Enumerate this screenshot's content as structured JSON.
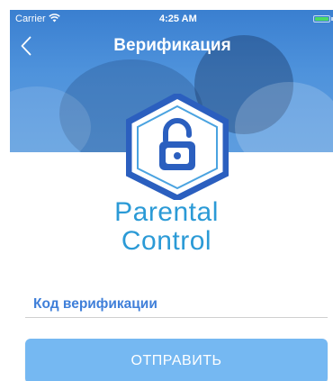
{
  "status_bar": {
    "carrier": "Carrier",
    "time": "4:25 AM",
    "wifi_icon": "wifi-icon",
    "battery_icon": "battery-icon"
  },
  "nav": {
    "title": "Верификация",
    "back_icon": "chevron-left-icon",
    "back_glyph": "‹"
  },
  "logo": {
    "line1": "Parental",
    "line2": "Control",
    "icon": "padlock-hexagon-icon"
  },
  "form": {
    "code_label": "Код верификации",
    "code_value": "",
    "submit_label": "ОТПРАВИТЬ"
  },
  "colors": {
    "header_blue": "#4f93dc",
    "label_blue": "#3f7fd9",
    "logo_text": "#2b9ad6",
    "button": "#75b8f2",
    "battery": "#4cd964"
  }
}
